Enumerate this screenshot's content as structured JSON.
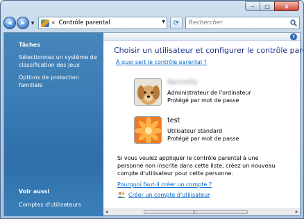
{
  "window": {
    "caption_min": "–",
    "caption_max": "□",
    "caption_close": "x"
  },
  "nav": {
    "back_glyph": "◀",
    "forward_glyph": "▶",
    "address_separator": "«",
    "address_text": "Contrôle parental",
    "refresh_glyph": "⟳",
    "search_placeholder": "Rechercher"
  },
  "help": {
    "glyph": "?"
  },
  "sidebar": {
    "tasks_title": "Tâches",
    "tasks": [
      "Sélectionnez un système de classification des jeux",
      "Options de protection familiale"
    ],
    "see_also_title": "Voir aussi",
    "see_also": [
      "Comptes d'utilisateurs"
    ]
  },
  "main": {
    "title": "Choisir un utilisateur et configurer le contrôle parental",
    "help_link": "À quoi sert le contrôle parental ?",
    "users": [
      {
        "name": "Nachvilly",
        "type": "Administrateur de l'ordinateur",
        "protection": "Protégé par mot de passe",
        "avatar": "dog-photo"
      },
      {
        "name": "test",
        "type": "Utilisateur standard",
        "protection": "Protégé par mot de passe",
        "avatar": "orange-flower"
      }
    ],
    "info_text": "Si vous voulez appliquer le contrôle parental à une personne non inscrite dans cette liste, créez un nouveau compte d'utilisateur pour cette personne.",
    "why_link": "Pourquoi faut-il créer un compte ?",
    "create_link": "Créer un compte d'utilisateur"
  },
  "colors": {
    "title_blue": "#1e3287",
    "link_blue": "#0066cc",
    "sidebar_blue": "#3c7db5"
  }
}
